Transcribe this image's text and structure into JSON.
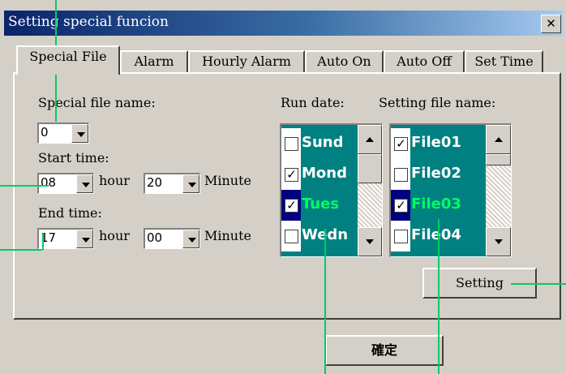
{
  "window": {
    "title": "Setting special funcion",
    "close": "✕"
  },
  "tabs": [
    "Special File",
    "Alarm",
    "Hourly Alarm",
    "Auto On",
    "Auto Off",
    "Set Time"
  ],
  "special_file": {
    "name_label": "Special file name:",
    "name_value": "0",
    "start_label": "Start time:",
    "start_hour": "08",
    "start_minute": "20",
    "end_label": "End time:",
    "end_hour": "17",
    "end_minute": "00",
    "hour_unit": "hour",
    "minute_unit": "Minute"
  },
  "run_date": {
    "label": "Run date:",
    "items": [
      {
        "text": "Sund",
        "checked": false,
        "selected": false
      },
      {
        "text": "Mond",
        "checked": true,
        "selected": false
      },
      {
        "text": "Tues",
        "checked": true,
        "selected": true
      },
      {
        "text": "Wedn",
        "checked": false,
        "selected": false
      }
    ]
  },
  "setting_file": {
    "label": "Setting file name:",
    "items": [
      {
        "text": "File01",
        "checked": true,
        "selected": false
      },
      {
        "text": "File02",
        "checked": false,
        "selected": false
      },
      {
        "text": "File03",
        "checked": true,
        "selected": true
      },
      {
        "text": "File04",
        "checked": false,
        "selected": false
      }
    ]
  },
  "buttons": {
    "setting": "Setting",
    "ok": "確定"
  },
  "colors": {
    "list_bg": "#008080",
    "selected_text": "#00ff66",
    "annotation_lines": "#00cc66"
  }
}
